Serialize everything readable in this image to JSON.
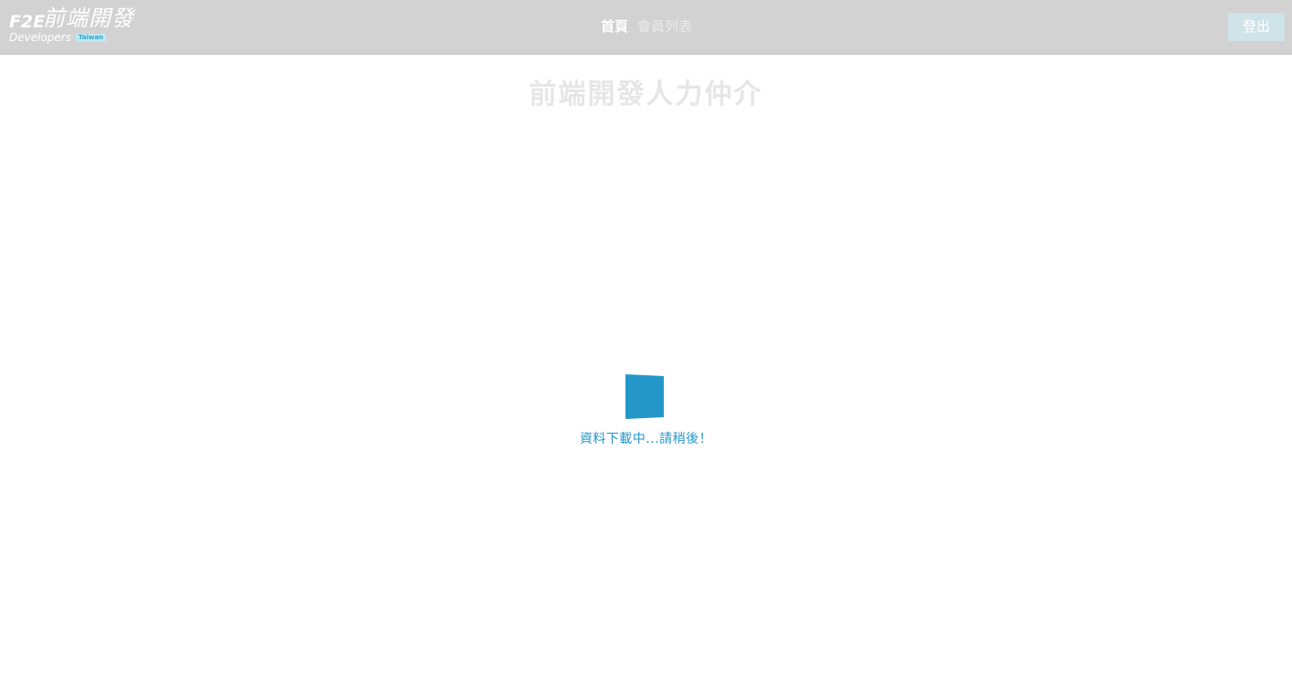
{
  "header": {
    "logo": {
      "mark": "F2E",
      "title_cn": "前端開發",
      "subtitle": "Developers",
      "badge": "Taiwan"
    },
    "nav": [
      {
        "label": "首頁",
        "active": true
      },
      {
        "label": "會員列表",
        "active": false
      }
    ],
    "logout_label": "登出"
  },
  "main": {
    "title": "前端開發人力仲介",
    "loading": {
      "text": "資料下載中...請稍後！",
      "icon": "flipping-square-icon"
    }
  },
  "colors": {
    "header_bg": "#d2d2d2",
    "accent": "#2497c8",
    "title_text": "#e6e6e6",
    "logout_bg": "#cfe3e9"
  }
}
